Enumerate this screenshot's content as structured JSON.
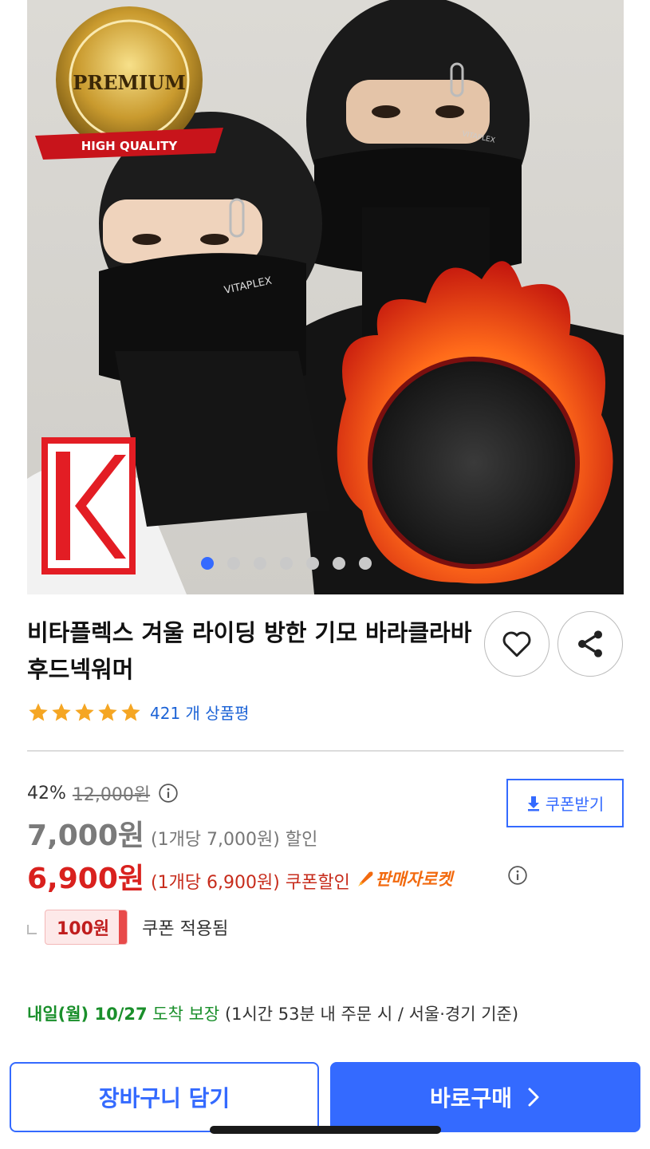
{
  "product": {
    "image_badges": {
      "premium_text": "PREMIUM",
      "quality_text": "HIGH QUALITY",
      "brand_print": "VITAPLEX"
    },
    "carousel_count": 7,
    "carousel_active_index": 0,
    "title": "비타플렉스 겨울 라이딩 방한 기모 바라클라바 후드넥워머",
    "rating_stars": 5,
    "review_count_text": "421 개 상품평"
  },
  "price": {
    "discount_rate": "42%",
    "original_price": "12,000원",
    "sale_price": "7,000원",
    "sale_unit_text": "(1개당 7,000원) 할인",
    "coupon_price": "6,900원",
    "coupon_unit_text": "(1개당 6,900원) 쿠폰할인",
    "seller_rocket": "판매자로켓",
    "coupon_download_label": "쿠폰받기",
    "coupon_amount": "100원",
    "coupon_applied_text": "쿠폰 적용됨"
  },
  "delivery": {
    "date": "내일(월) 10/27",
    "guarantee": "도착 보장",
    "note": "(1시간 53분 내 주문 시 / 서울·경기 기준)"
  },
  "actions": {
    "cart_label": "장바구니 담기",
    "buy_label": "바로구매"
  },
  "colors": {
    "accent": "#346aff",
    "coupon_red": "#d9211e",
    "delivery_green": "#1a8f2b",
    "rating_star": "#f5a623"
  }
}
